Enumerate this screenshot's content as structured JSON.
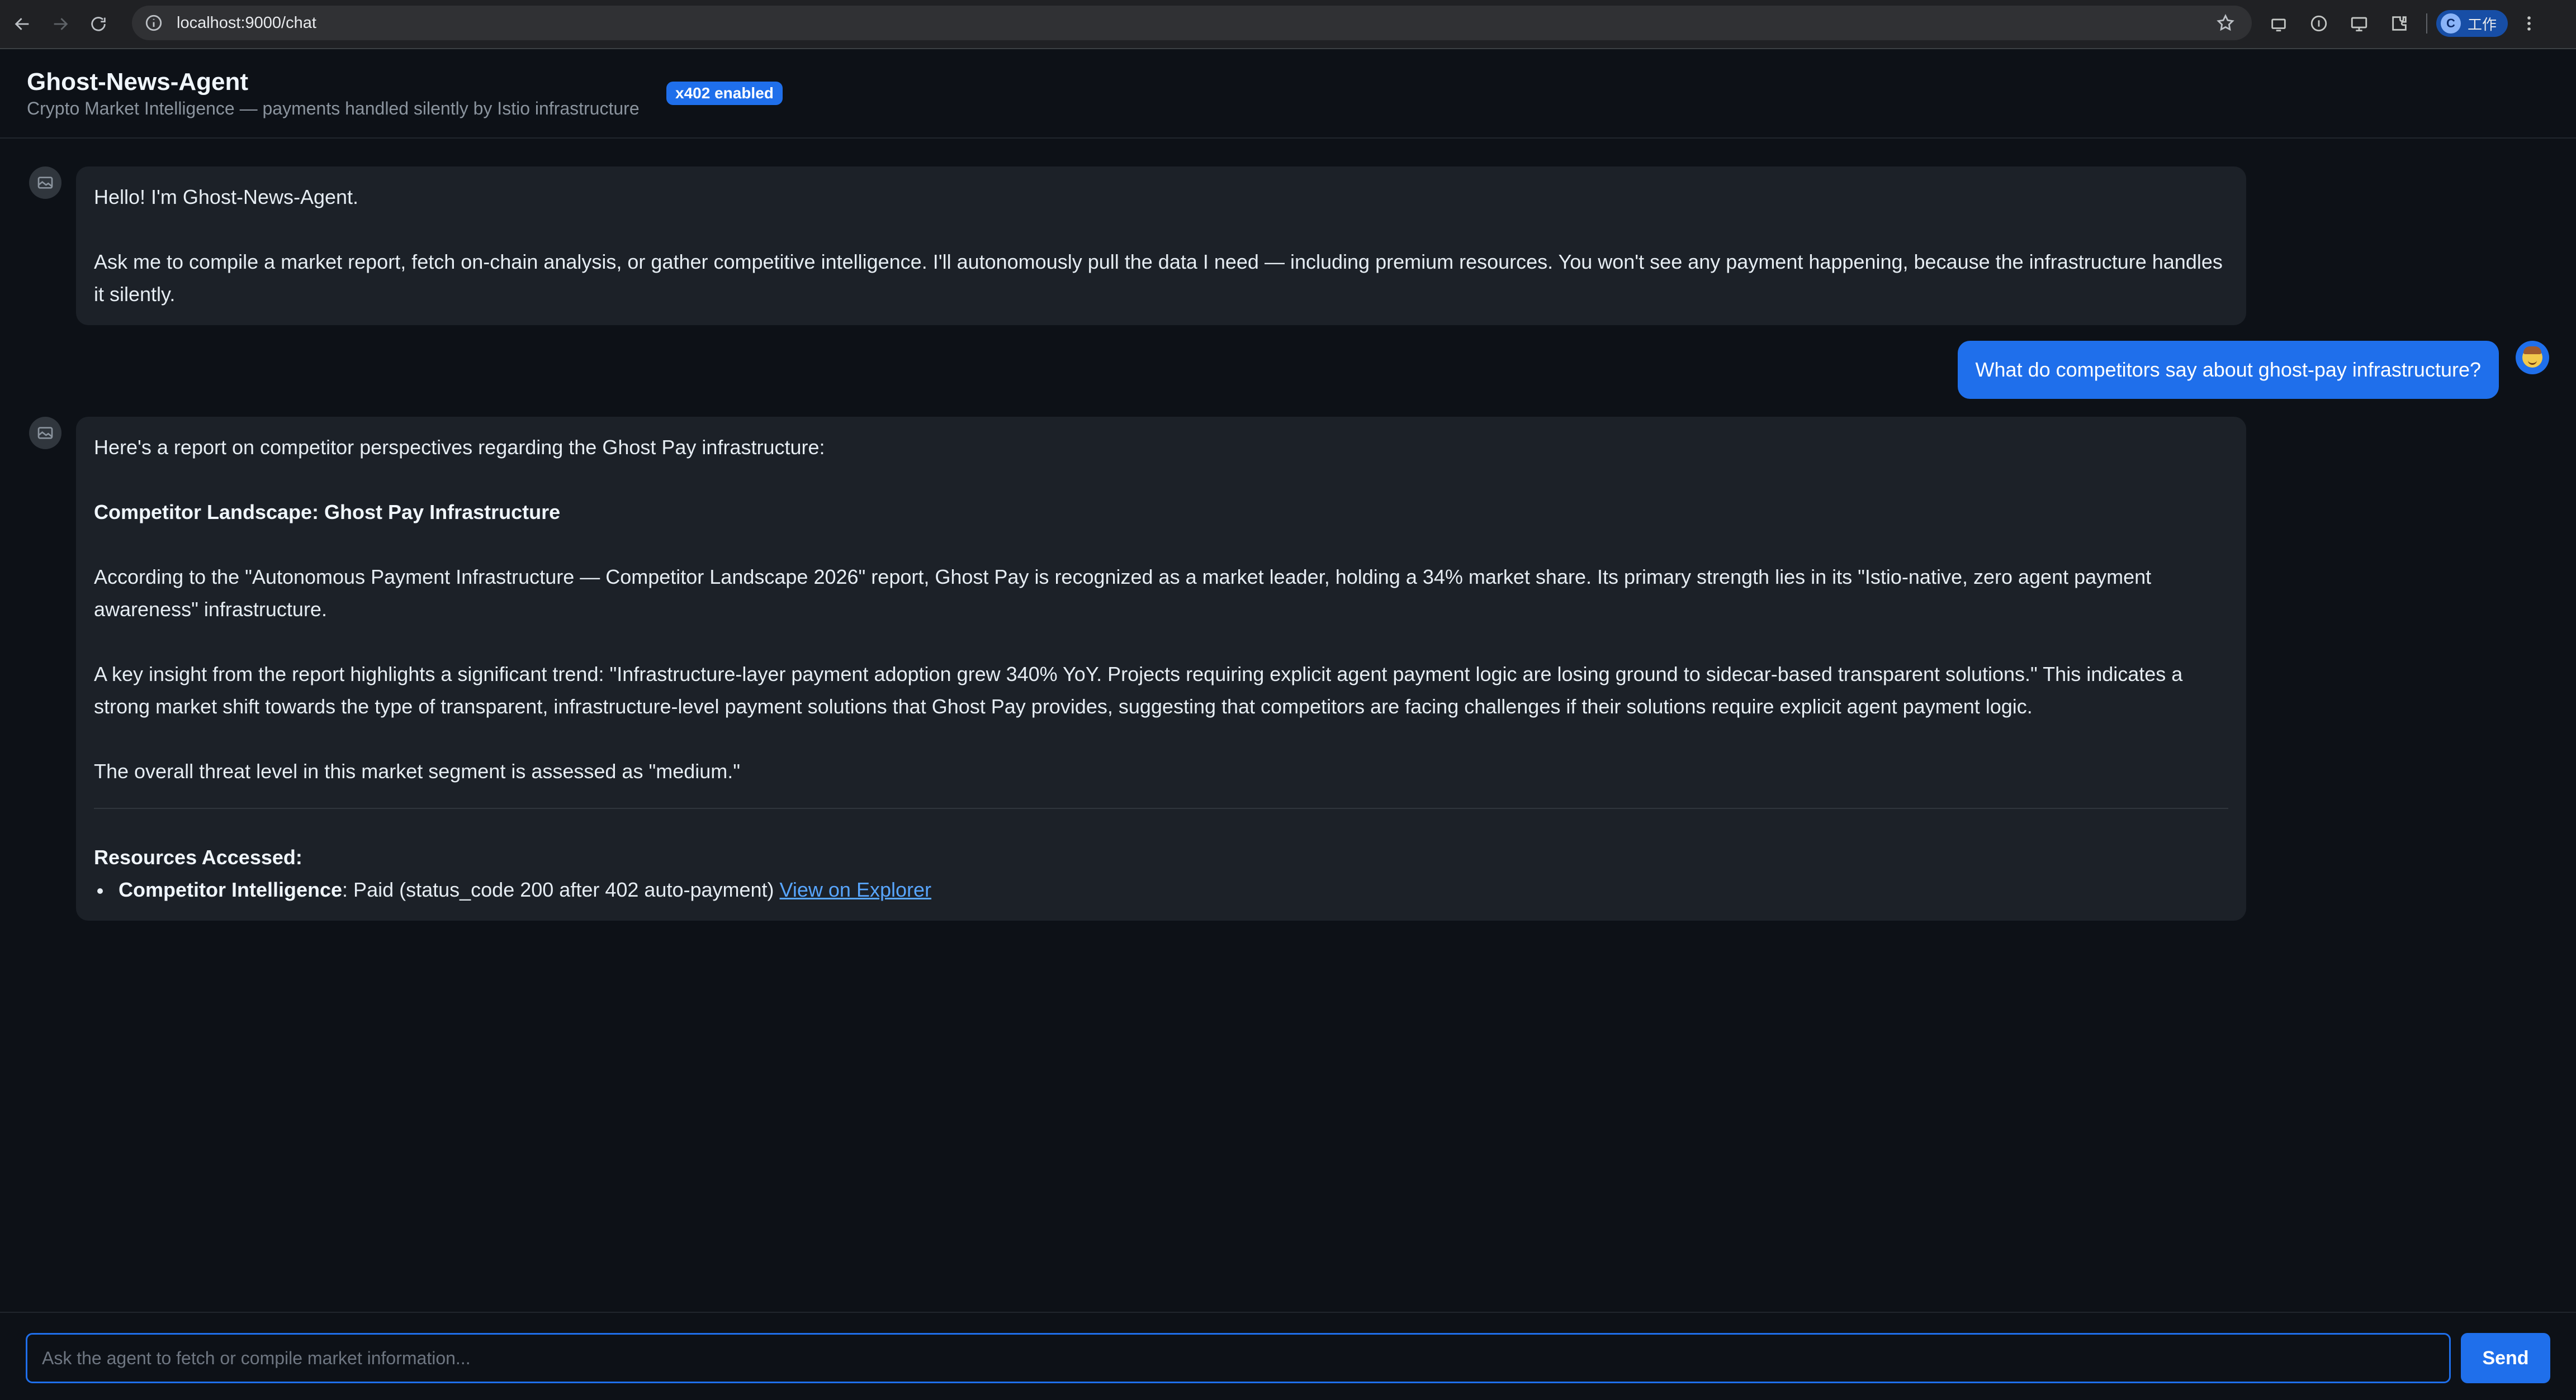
{
  "browser": {
    "url": "localhost:9000/chat",
    "profile_initial": "C",
    "profile_label": "工作"
  },
  "header": {
    "title": "Ghost-News-Agent",
    "subtitle": "Crypto Market Intelligence — payments handled silently by Istio infrastructure",
    "badge": "x402 enabled"
  },
  "messages": {
    "greeting": {
      "line1": "Hello! I'm Ghost-News-Agent.",
      "line2": "Ask me to compile a market report, fetch on-chain analysis, or gather competitive intelligence. I'll autonomously pull the data I need — including premium resources. You won't see any payment happening, because the infrastructure handles it silently."
    },
    "user_question": "What do competitors say about ghost-pay infrastructure?",
    "report": {
      "intro": "Here's a report on competitor perspectives regarding the Ghost Pay infrastructure:",
      "heading": "Competitor Landscape: Ghost Pay Infrastructure",
      "para1": "According to the \"Autonomous Payment Infrastructure — Competitor Landscape 2026\" report, Ghost Pay is recognized as a market leader, holding a 34% market share. Its primary strength lies in its \"Istio-native, zero agent payment awareness\" infrastructure.",
      "para2": "A key insight from the report highlights a significant trend: \"Infrastructure-layer payment adoption grew 340% YoY. Projects requiring explicit agent payment logic are losing ground to sidecar-based transparent solutions.\" This indicates a strong market shift towards the type of transparent, infrastructure-level payment solutions that Ghost Pay provides, suggesting that competitors are facing challenges if their solutions require explicit agent payment logic.",
      "para3": "The overall threat level in this market segment is assessed as \"medium.\"",
      "resources_heading": "Resources Accessed:",
      "resource_name": "Competitor Intelligence",
      "resource_status": ": Paid (status_code 200 after 402 auto-payment) ",
      "resource_link": "View on Explorer"
    }
  },
  "composer": {
    "placeholder": "Ask the agent to fetch or compile market information...",
    "send_label": "Send"
  }
}
